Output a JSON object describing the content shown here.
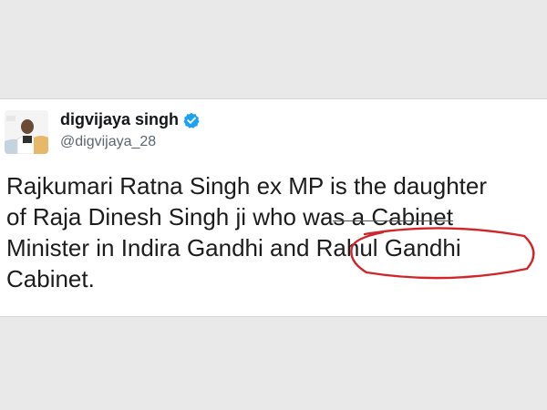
{
  "tweet": {
    "author": {
      "display_name": "digvijaya singh",
      "handle": "@digvijaya_28",
      "verified_icon": "verified-badge-icon",
      "avatar_icon": "avatar-photo"
    },
    "lines": [
      {
        "text": "Rajkumari Ratna Singh ex MP is the daughter"
      },
      {
        "before": "of Raja Dinesh Singh ji who wa",
        "struck": "s a Cabinet"
      },
      {
        "before": "Minister in Indira Gandhi and ",
        "emph": "Rahul",
        "after": " Gandhi"
      },
      {
        "text": "Cabinet."
      }
    ]
  },
  "colors": {
    "verified": "#1da1f2",
    "annotation": "#d0262a"
  }
}
